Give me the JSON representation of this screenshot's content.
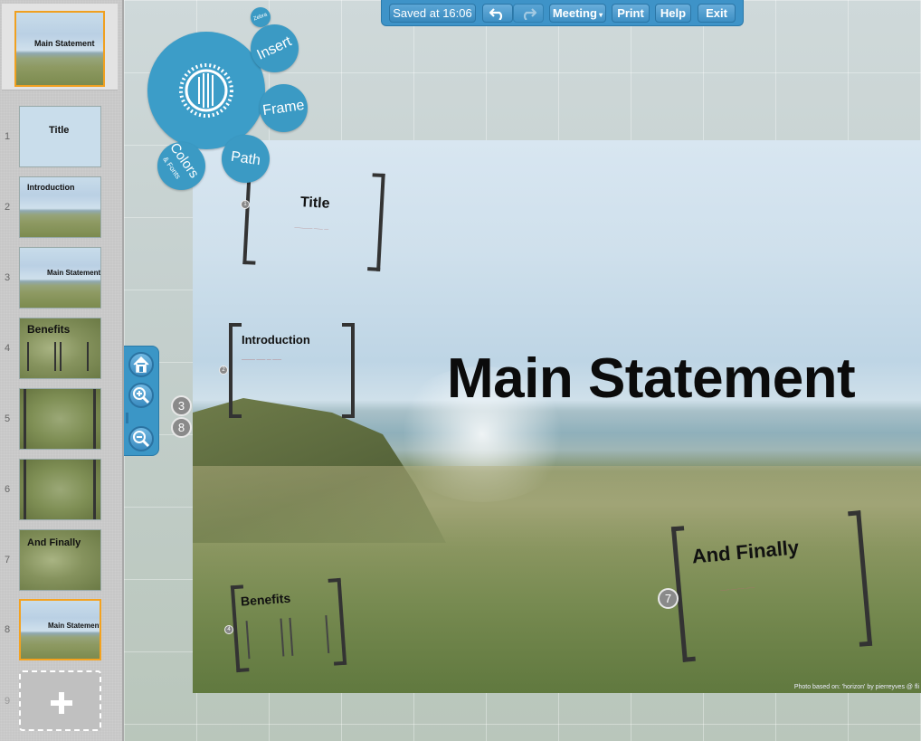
{
  "toolbar": {
    "saved": "Saved at 16:06",
    "meeting": "Meeting",
    "print": "Print",
    "help": "Help",
    "exit": "Exit"
  },
  "bubble_menu": {
    "insert": "Insert",
    "frame": "Frame",
    "path": "Path",
    "colors": "Colors",
    "fonts": "& Fonts",
    "small": "Zebra"
  },
  "sidebar": {
    "overview_label": "Main Statement",
    "slides": [
      {
        "num": "1",
        "label": "Title"
      },
      {
        "num": "2",
        "label": "Introduction"
      },
      {
        "num": "3",
        "label": "Main Statement"
      },
      {
        "num": "4",
        "label": "Benefits"
      },
      {
        "num": "5",
        "label": ""
      },
      {
        "num": "6",
        "label": ""
      },
      {
        "num": "7",
        "label": "And Finally"
      },
      {
        "num": "8",
        "label": "Main Statement"
      },
      {
        "num": "9",
        "label": ""
      }
    ],
    "add_icon": "plus-icon"
  },
  "canvas": {
    "title_frame": "Title",
    "intro_frame": "Introduction",
    "main_statement": "Main Statement",
    "benefits_frame": "Benefits",
    "finally_frame": "And Finally",
    "path_badges": [
      "3",
      "8",
      "7"
    ],
    "photo_credit": "Photo based on: 'horizon' by pierreyves @ fli"
  },
  "colors": {
    "accent": "#3b96c6",
    "selection": "#f4a21f"
  }
}
